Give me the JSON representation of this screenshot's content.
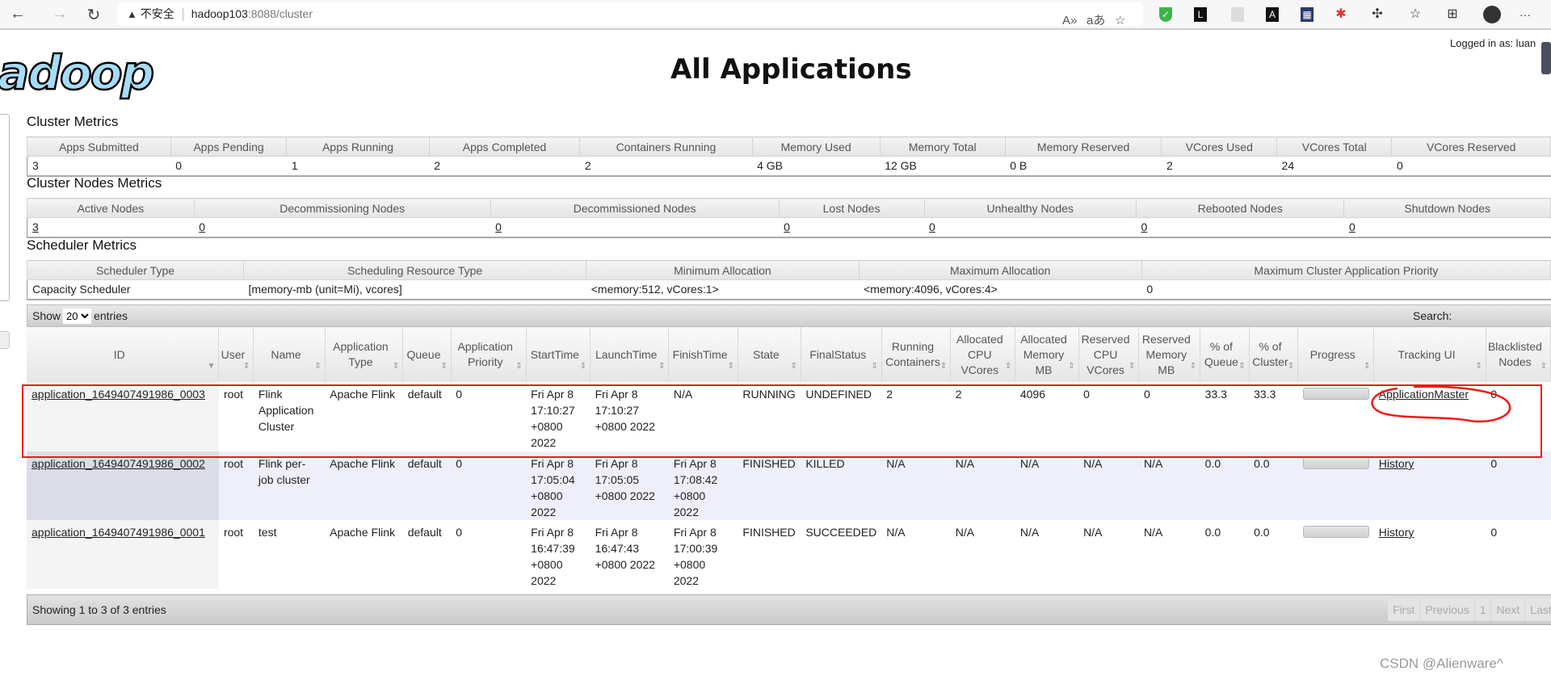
{
  "browser": {
    "security": "不安全",
    "url_host": "hadoop103",
    "url_rest": ":8088/cluster",
    "back_icon": "arrow-left",
    "forward_icon": "arrow-right",
    "reload_icon": "reload",
    "more": "···"
  },
  "header": {
    "logo": "hadoop",
    "title": "All Applications",
    "logged_in": "Logged in as: luan"
  },
  "cluster_metrics": {
    "title": "Cluster Metrics",
    "headers": [
      "Apps Submitted",
      "Apps Pending",
      "Apps Running",
      "Apps Completed",
      "Containers Running",
      "Memory Used",
      "Memory Total",
      "Memory Reserved",
      "VCores Used",
      "VCores Total",
      "VCores Reserved"
    ],
    "values": [
      "3",
      "0",
      "1",
      "2",
      "2",
      "4 GB",
      "12 GB",
      "0 B",
      "2",
      "24",
      "0"
    ]
  },
  "node_metrics": {
    "title": "Cluster Nodes Metrics",
    "headers": [
      "Active Nodes",
      "Decommissioning Nodes",
      "Decommissioned Nodes",
      "Lost Nodes",
      "Unhealthy Nodes",
      "Rebooted Nodes",
      "Shutdown Nodes"
    ],
    "values": [
      "3",
      "0",
      "0",
      "0",
      "0",
      "0",
      "0"
    ]
  },
  "scheduler_metrics": {
    "title": "Scheduler Metrics",
    "headers": [
      "Scheduler Type",
      "Scheduling Resource Type",
      "Minimum Allocation",
      "Maximum Allocation",
      "Maximum Cluster Application Priority"
    ],
    "values": [
      "Capacity Scheduler",
      "[memory-mb (unit=Mi), vcores]",
      "<memory:512, vCores:1>",
      "<memory:4096, vCores:4>",
      "0"
    ]
  },
  "apps": {
    "show_label": "Show",
    "entries_label": "entries",
    "page_size": "20",
    "search_label": "Search:",
    "search_value": "",
    "columns": [
      "ID",
      "User",
      "Name",
      "Application Type",
      "Queue",
      "Application Priority",
      "StartTime",
      "LaunchTime",
      "FinishTime",
      "State",
      "FinalStatus",
      "Running Containers",
      "Allocated CPU VCores",
      "Allocated Memory MB",
      "Reserved CPU VCores",
      "Reserved Memory MB",
      "% of Queue",
      "% of Cluster",
      "Progress",
      "Tracking UI",
      "Blacklisted Nodes"
    ],
    "rows": [
      {
        "id": "application_1649407491986_0003",
        "user": "root",
        "name": "Flink Application Cluster",
        "type": "Apache Flink",
        "queue": "default",
        "priority": "0",
        "start": "Fri Apr 8 17:10:27 +0800 2022",
        "launch": "Fri Apr 8 17:10:27 +0800 2022",
        "finish": "N/A",
        "state": "RUNNING",
        "final": "UNDEFINED",
        "containers": "2",
        "alloc_cpu": "2",
        "alloc_mem": "4096",
        "res_cpu": "0",
        "res_mem": "0",
        "pct_queue": "33.3",
        "pct_cluster": "33.3",
        "progress": 0,
        "tracking": "ApplicationMaster",
        "blacklisted": "0"
      },
      {
        "id": "application_1649407491986_0002",
        "user": "root",
        "name": "Flink per-job cluster",
        "type": "Apache Flink",
        "queue": "default",
        "priority": "0",
        "start": "Fri Apr 8 17:05:04 +0800 2022",
        "launch": "Fri Apr 8 17:05:05 +0800 2022",
        "finish": "Fri Apr 8 17:08:42 +0800 2022",
        "state": "FINISHED",
        "final": "KILLED",
        "containers": "N/A",
        "alloc_cpu": "N/A",
        "alloc_mem": "N/A",
        "res_cpu": "N/A",
        "res_mem": "N/A",
        "pct_queue": "0.0",
        "pct_cluster": "0.0",
        "progress": 0,
        "tracking": "History",
        "blacklisted": "0"
      },
      {
        "id": "application_1649407491986_0001",
        "user": "root",
        "name": "test",
        "type": "Apache Flink",
        "queue": "default",
        "priority": "0",
        "start": "Fri Apr 8 16:47:39 +0800 2022",
        "launch": "Fri Apr 8 16:47:43 +0800 2022",
        "finish": "Fri Apr 8 17:00:39 +0800 2022",
        "state": "FINISHED",
        "final": "SUCCEEDED",
        "containers": "N/A",
        "alloc_cpu": "N/A",
        "alloc_mem": "N/A",
        "res_cpu": "N/A",
        "res_mem": "N/A",
        "pct_queue": "0.0",
        "pct_cluster": "0.0",
        "progress": 0,
        "tracking": "History",
        "blacklisted": "0"
      }
    ],
    "info": "Showing 1 to 3 of 3 entries",
    "pager": [
      "First",
      "Previous",
      "1",
      "Next",
      "Last"
    ]
  },
  "annotation_color": "#f01818",
  "watermark": "CSDN @Alienware^"
}
